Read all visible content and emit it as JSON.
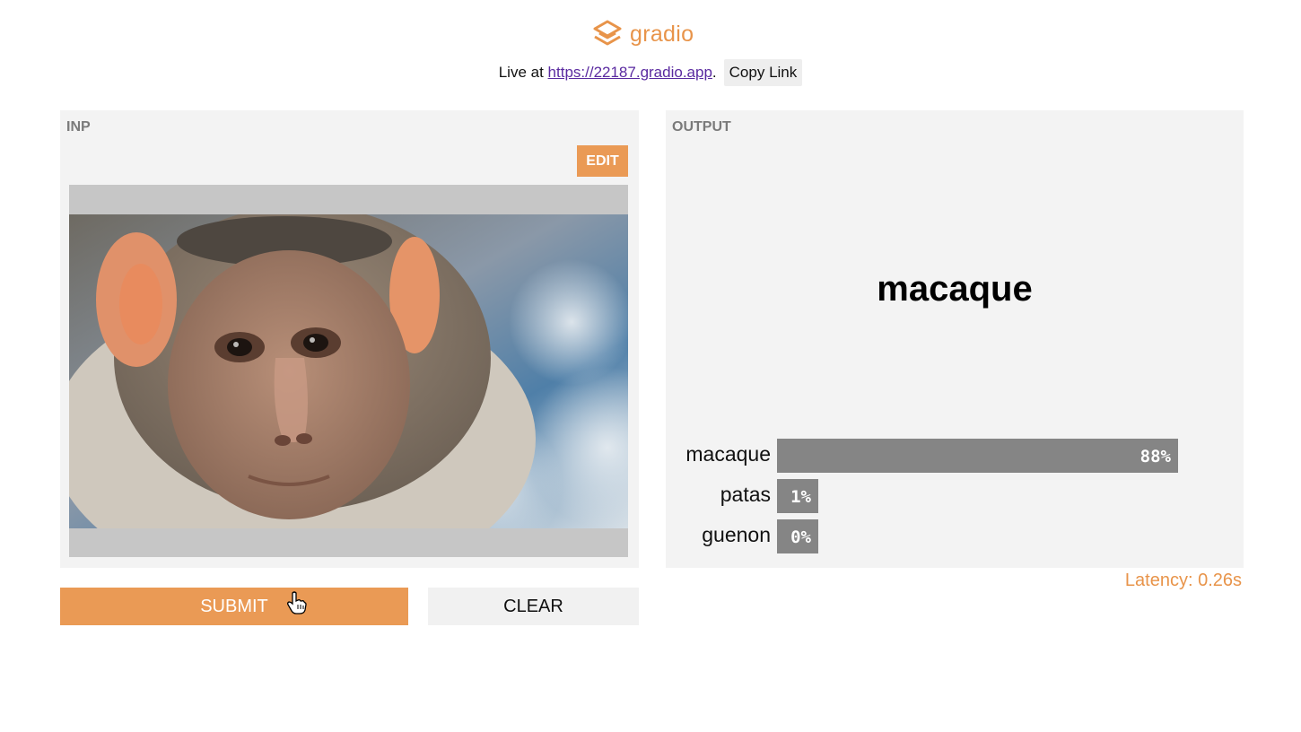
{
  "header": {
    "logo_icon": "gradio-logo-icon",
    "logo_text": "gradio",
    "live_prefix": "Live at ",
    "live_url": "https://22187.gradio.app",
    "live_suffix": ".",
    "copy_label": "Copy Link"
  },
  "input_panel": {
    "label": "INP",
    "edit_label": "EDIT",
    "image_desc": "macaque-photo"
  },
  "output_panel": {
    "label": "OUTPUT",
    "predicted_label": "macaque",
    "confidences": [
      {
        "name": "macaque",
        "value": 0.88,
        "text": "88%"
      },
      {
        "name": "patas",
        "value": 0.01,
        "text": "1%"
      },
      {
        "name": "guenon",
        "value": 0.0,
        "text": "0%"
      }
    ]
  },
  "latency": "Latency: 0.26s",
  "actions": {
    "submit_label": "SUBMIT",
    "clear_label": "CLEAR"
  },
  "colors": {
    "accent": "#ea9a55",
    "panel_bg": "#f3f3f3",
    "bar": "#858585",
    "link": "#5a2aa0"
  }
}
